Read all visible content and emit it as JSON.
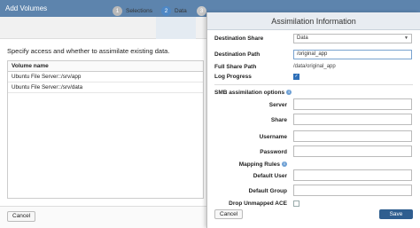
{
  "dialog": {
    "title": "Add Volumes",
    "steps": [
      {
        "num": "1",
        "label": "Selections"
      },
      {
        "num": "2",
        "label": "Data"
      },
      {
        "num": "3",
        "label": ""
      }
    ],
    "intro": "Specify access and whether to assimilate existing data.",
    "table": {
      "column": "Volume name",
      "rows": [
        "Ubuntu File Server::/srv/app",
        "Ubuntu File Server::/srv/data"
      ]
    },
    "cancel_label": "Cancel"
  },
  "overlay": {
    "title": "Assimilation Information",
    "destination_share_label": "Destination Share",
    "destination_share_value": "Data",
    "destination_path_label": "Destination Path",
    "destination_path_value": "/original_app",
    "full_share_path_label": "Full Share Path",
    "full_share_path_value": "/data/original_app",
    "log_progress_label": "Log Progress",
    "log_progress_checked": true,
    "smb_label": "SMB assimilation options",
    "fields": {
      "server": "Server",
      "share": "Share",
      "username": "Username",
      "password": "Password",
      "mapping_rules": "Mapping Rules",
      "default_user": "Default User",
      "default_group": "Default Group",
      "drop_unmapped_ace": "Drop Unmapped ACE"
    },
    "cancel_label": "Cancel",
    "save_label": "Save"
  },
  "colors": {
    "title_bar": "#5d84ad",
    "active_step": "#4d87c5",
    "save_button": "#2f5e8f"
  }
}
